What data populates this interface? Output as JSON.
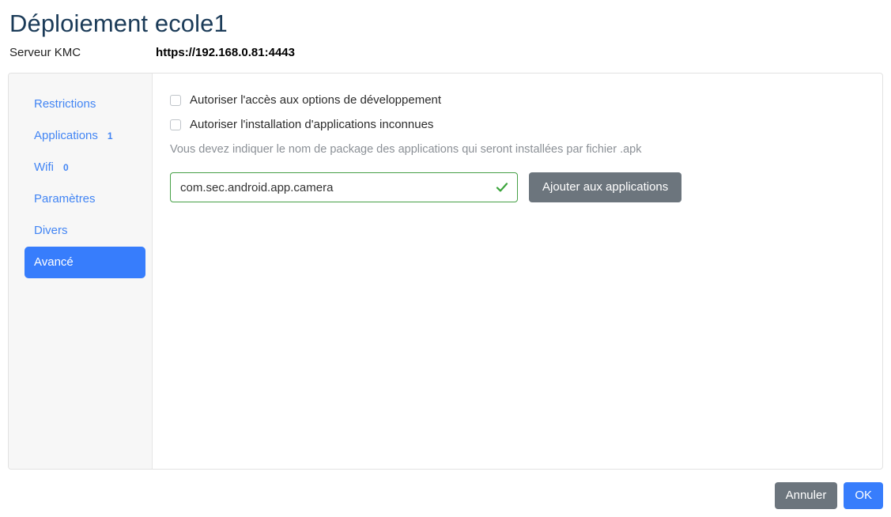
{
  "header": {
    "title": "Déploiement ecole1",
    "server_label": "Serveur KMC",
    "server_url": "https://192.168.0.81:4443"
  },
  "sidebar": {
    "items": [
      {
        "label": "Restrictions",
        "badge": "",
        "active": false
      },
      {
        "label": "Applications",
        "badge": "1",
        "active": false
      },
      {
        "label": "Wifi",
        "badge": "0",
        "active": false
      },
      {
        "label": "Paramètres",
        "badge": "",
        "active": false
      },
      {
        "label": "Divers",
        "badge": "",
        "active": false
      },
      {
        "label": "Avancé",
        "badge": "",
        "active": true
      }
    ]
  },
  "content": {
    "checkboxes": [
      {
        "label": "Autoriser l'accès aux options de développement",
        "checked": false
      },
      {
        "label": "Autoriser l'installation d'applications inconnues",
        "checked": false
      }
    ],
    "helper_text": "Vous devez indiquer le nom de package des applications qui seront installées par fichier .apk",
    "package_input": {
      "value": "com.sec.android.app.camera",
      "placeholder": "",
      "valid": true,
      "valid_icon": "check-icon"
    },
    "add_button_label": "Ajouter aux applications"
  },
  "footer": {
    "cancel_label": "Annuler",
    "ok_label": "OK"
  },
  "colors": {
    "accent_blue": "#377dfc",
    "link_blue": "#4285f4",
    "title_navy": "#1b3b58",
    "gray_button": "#6c757d",
    "valid_green": "#46a046",
    "sidebar_bg": "#f7f7f7",
    "helper_gray": "#8b9096"
  }
}
